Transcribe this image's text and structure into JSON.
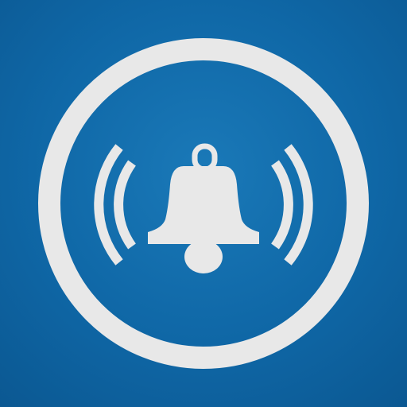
{
  "icon": {
    "name": "notification-bell-icon",
    "background_color": "#0f67a6",
    "foreground_color": "#e8e8e8"
  }
}
